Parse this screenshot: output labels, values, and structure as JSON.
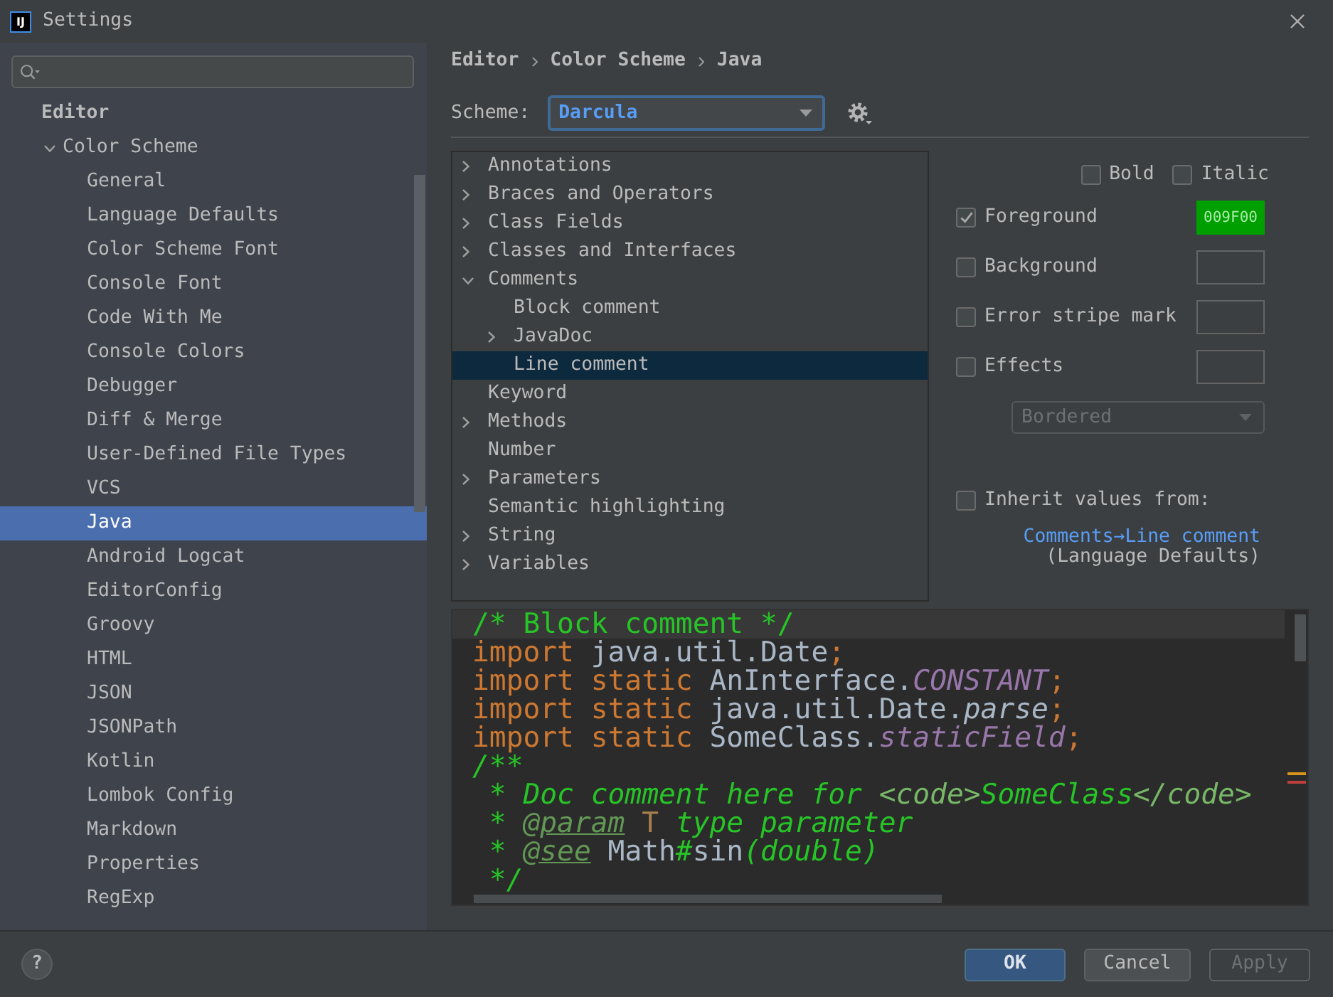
{
  "window": {
    "logo_text": "IJ",
    "title": "Settings"
  },
  "sidebar": {
    "heading": "Editor",
    "items": [
      {
        "label": "Color Scheme",
        "expanded": true,
        "selected": false,
        "children": [
          {
            "label": "General",
            "selected": false
          },
          {
            "label": "Language Defaults",
            "selected": false
          },
          {
            "label": "Color Scheme Font",
            "selected": false
          },
          {
            "label": "Console Font",
            "selected": false
          },
          {
            "label": "Code With Me",
            "selected": false
          },
          {
            "label": "Console Colors",
            "selected": false
          },
          {
            "label": "Debugger",
            "selected": false
          },
          {
            "label": "Diff & Merge",
            "selected": false
          },
          {
            "label": "User-Defined File Types",
            "selected": false
          },
          {
            "label": "VCS",
            "selected": false
          },
          {
            "label": "Java",
            "selected": true
          },
          {
            "label": "Android Logcat",
            "selected": false
          },
          {
            "label": "EditorConfig",
            "selected": false
          },
          {
            "label": "Groovy",
            "selected": false
          },
          {
            "label": "HTML",
            "selected": false
          },
          {
            "label": "JSON",
            "selected": false
          },
          {
            "label": "JSONPath",
            "selected": false
          },
          {
            "label": "Kotlin",
            "selected": false
          },
          {
            "label": "Lombok Config",
            "selected": false
          },
          {
            "label": "Markdown",
            "selected": false
          },
          {
            "label": "Properties",
            "selected": false
          },
          {
            "label": "RegExp",
            "selected": false
          }
        ]
      }
    ]
  },
  "breadcrumb": [
    "Editor",
    "Color Scheme",
    "Java"
  ],
  "scheme": {
    "label": "Scheme:",
    "value": "Darcula",
    "focused": true
  },
  "categories": [
    {
      "label": "Annotations",
      "kind": "group",
      "expanded": false,
      "selected": false
    },
    {
      "label": "Braces and Operators",
      "kind": "group",
      "expanded": false,
      "selected": false
    },
    {
      "label": "Class Fields",
      "kind": "group",
      "expanded": false,
      "selected": false
    },
    {
      "label": "Classes and Interfaces",
      "kind": "group",
      "expanded": false,
      "selected": false
    },
    {
      "label": "Comments",
      "kind": "group",
      "expanded": true,
      "selected": false,
      "children": [
        {
          "label": "Block comment",
          "kind": "leaf",
          "selected": false
        },
        {
          "label": "JavaDoc",
          "kind": "group",
          "expanded": false,
          "selected": false
        },
        {
          "label": "Line comment",
          "kind": "leaf",
          "selected": true
        }
      ]
    },
    {
      "label": "Keyword",
      "kind": "leaf",
      "selected": false
    },
    {
      "label": "Methods",
      "kind": "group",
      "expanded": false,
      "selected": false
    },
    {
      "label": "Number",
      "kind": "leaf",
      "selected": false
    },
    {
      "label": "Parameters",
      "kind": "group",
      "expanded": false,
      "selected": false
    },
    {
      "label": "Semantic highlighting",
      "kind": "leaf",
      "selected": false
    },
    {
      "label": "String",
      "kind": "group",
      "expanded": false,
      "selected": false
    },
    {
      "label": "Variables",
      "kind": "group",
      "expanded": false,
      "selected": false
    }
  ],
  "style_options": [
    {
      "label": "Bold",
      "checked": false
    },
    {
      "label": "Italic",
      "checked": false
    }
  ],
  "attributes": [
    {
      "label": "Foreground",
      "checked": true,
      "value": "009F00",
      "color": "#009f00"
    },
    {
      "label": "Background",
      "checked": false
    },
    {
      "label": "Error stripe mark",
      "checked": false
    },
    {
      "label": "Effects",
      "checked": false
    }
  ],
  "effect_type": {
    "value": "Bordered",
    "disabled": true
  },
  "inherit": {
    "label": "Inherit values from:",
    "checked": false,
    "link": "Comments→Line comment",
    "note": "(Language Defaults)"
  },
  "preview": {
    "lines": [
      {
        "current": true,
        "tokens": [
          {
            "text": "/* Block comment */",
            "kind": "block_comment"
          }
        ]
      },
      {
        "current": false,
        "tokens": [
          {
            "text": "import",
            "kind": "keyword"
          },
          {
            "text": " java.util.Date",
            "kind": "plain"
          },
          {
            "text": ";",
            "kind": "keyword"
          }
        ]
      },
      {
        "current": false,
        "tokens": [
          {
            "text": "import static",
            "kind": "keyword"
          },
          {
            "text": " AnInterface.",
            "kind": "plain"
          },
          {
            "text": "CONSTANT",
            "kind": "constant"
          },
          {
            "text": ";",
            "kind": "keyword"
          }
        ]
      },
      {
        "current": false,
        "tokens": [
          {
            "text": "import static",
            "kind": "keyword"
          },
          {
            "text": " java.util.Date.",
            "kind": "plain"
          },
          {
            "text": "parse",
            "kind": "static_method"
          },
          {
            "text": ";",
            "kind": "keyword"
          }
        ]
      },
      {
        "current": false,
        "tokens": [
          {
            "text": "import static",
            "kind": "keyword"
          },
          {
            "text": " SomeClass.",
            "kind": "plain"
          },
          {
            "text": "staticField",
            "kind": "static_field"
          },
          {
            "text": ";",
            "kind": "keyword"
          }
        ]
      },
      {
        "current": false,
        "tokens": [
          {
            "text": "/**",
            "kind": "doc"
          }
        ]
      },
      {
        "current": false,
        "tokens": [
          {
            "text": " * Doc comment here for ",
            "kind": "doc"
          },
          {
            "text": "<code>",
            "kind": "doc_markup"
          },
          {
            "text": "SomeClass",
            "kind": "doc"
          },
          {
            "text": "</code>",
            "kind": "doc_markup"
          }
        ]
      },
      {
        "current": false,
        "tokens": [
          {
            "text": " * ",
            "kind": "doc"
          },
          {
            "text": "@param",
            "kind": "doc_tag"
          },
          {
            "text": " T",
            "kind": "type_param"
          },
          {
            "text": " type parameter",
            "kind": "doc"
          }
        ]
      },
      {
        "current": false,
        "tokens": [
          {
            "text": " * ",
            "kind": "doc"
          },
          {
            "text": "@see",
            "kind": "doc_tag"
          },
          {
            "text": " Math",
            "kind": "plain"
          },
          {
            "text": "#",
            "kind": "doc"
          },
          {
            "text": "sin",
            "kind": "plain"
          },
          {
            "text": "(double)",
            "kind": "doc"
          }
        ]
      },
      {
        "current": false,
        "tokens": [
          {
            "text": " */",
            "kind": "doc"
          }
        ]
      }
    ]
  },
  "help": "?",
  "buttons": [
    {
      "label": "OK",
      "kind": "primary",
      "disabled": false
    },
    {
      "label": "Cancel",
      "kind": "secondary",
      "disabled": false
    },
    {
      "label": "Apply",
      "kind": "secondary",
      "disabled": true
    }
  ]
}
